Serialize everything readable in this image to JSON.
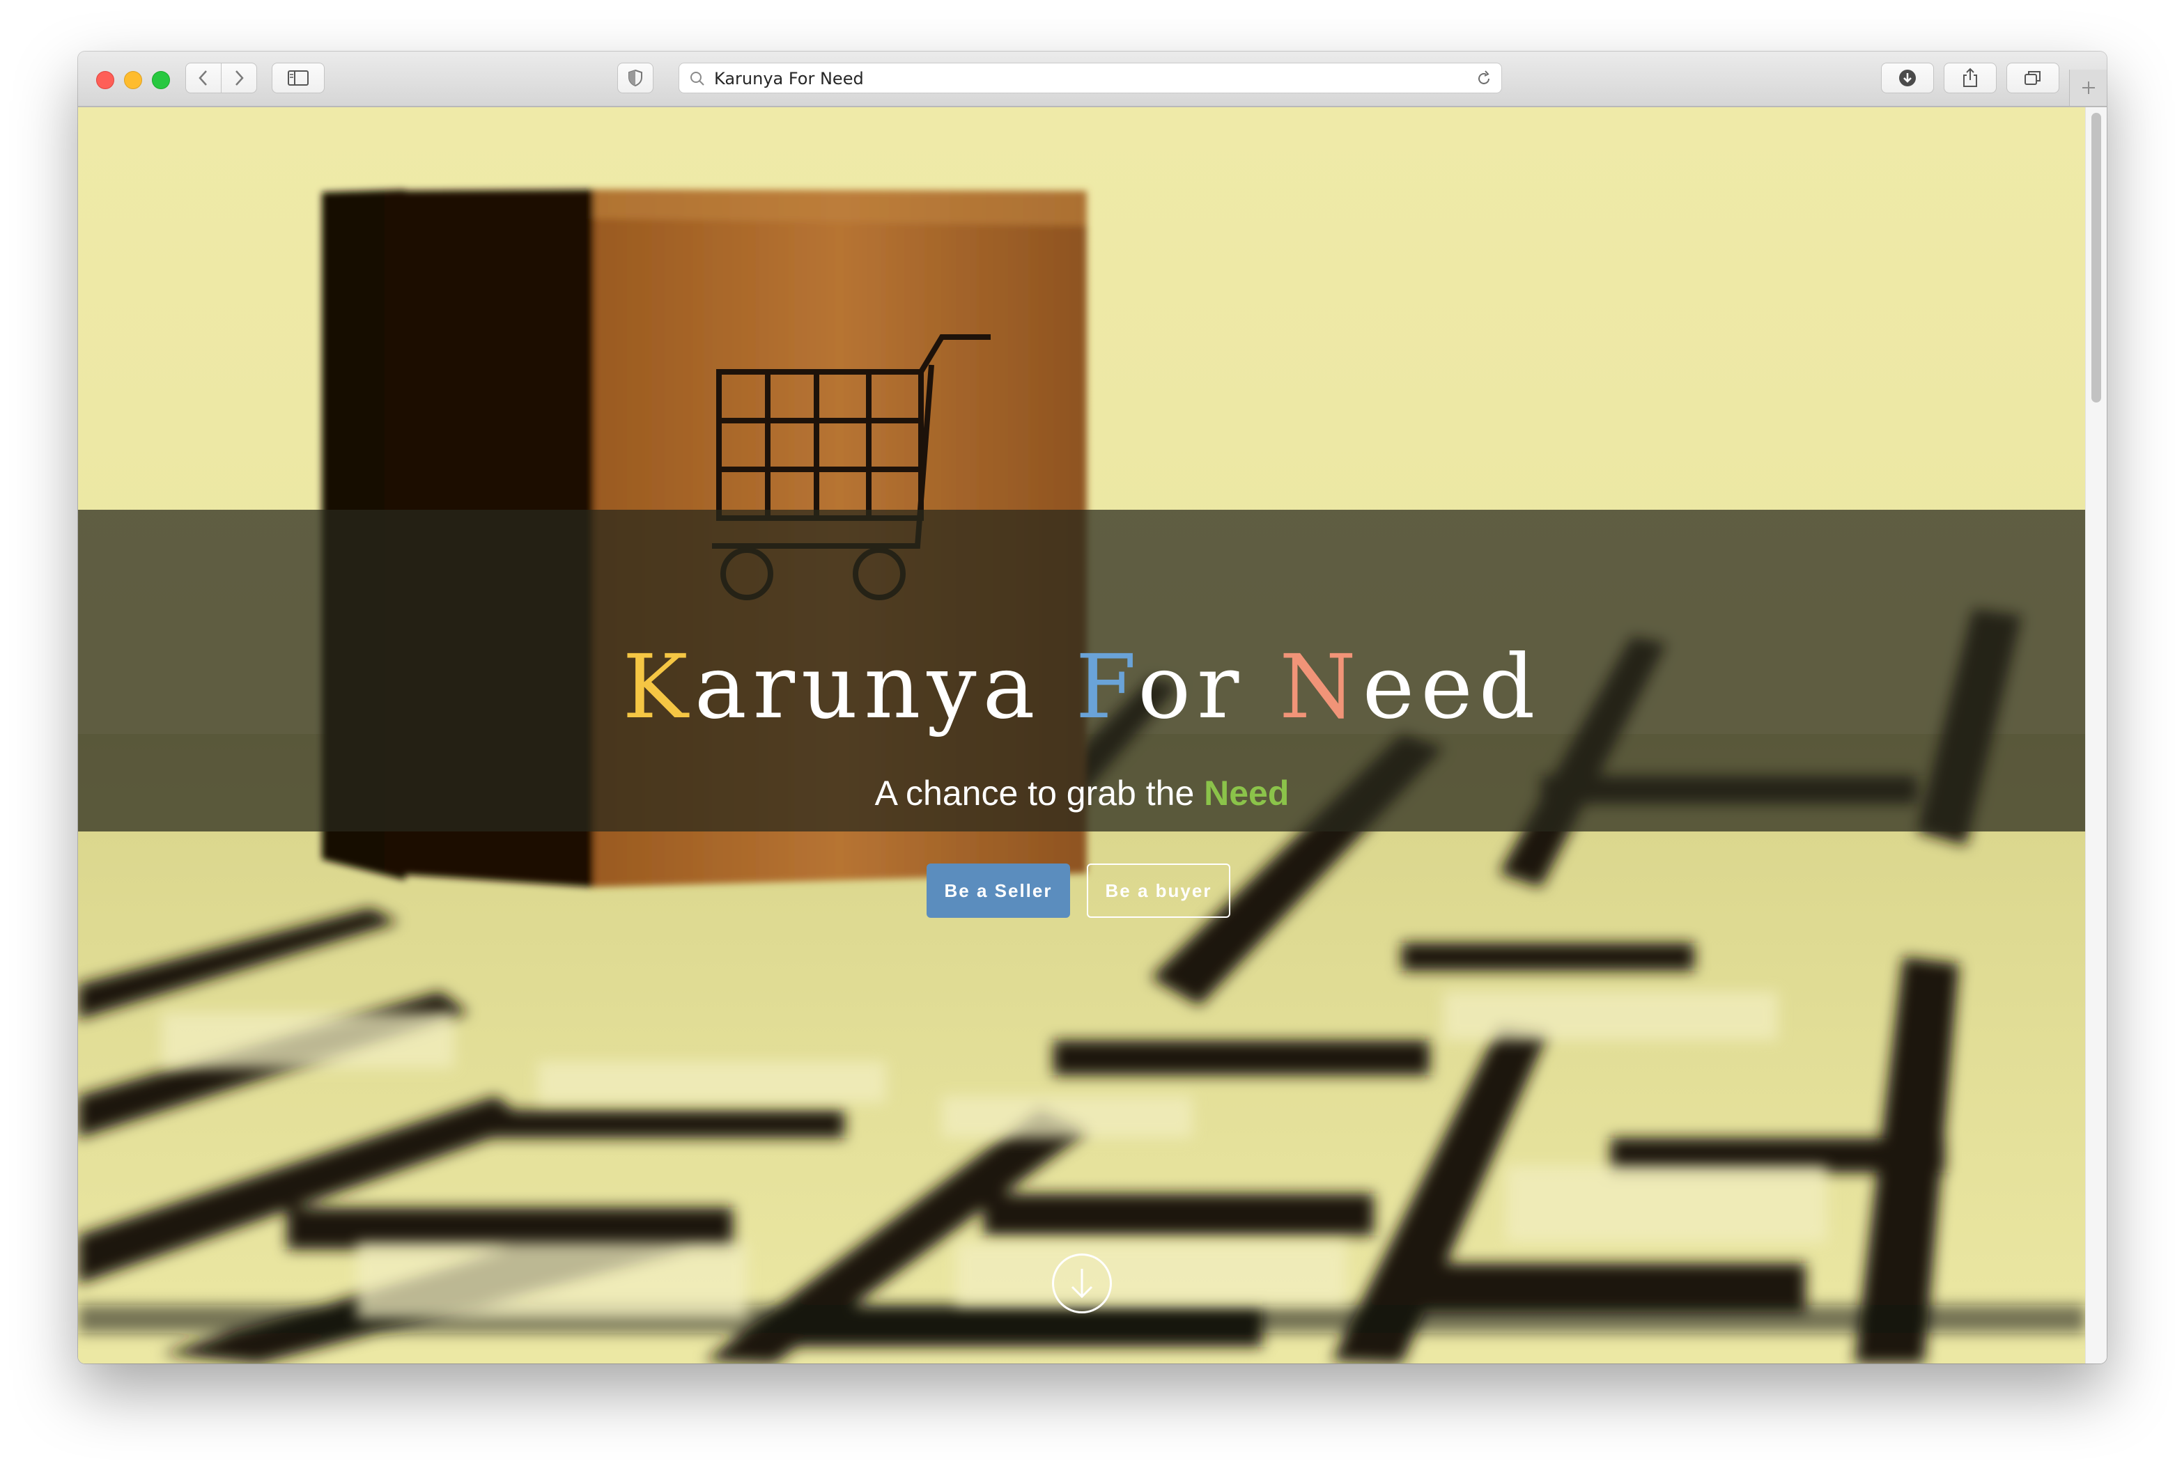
{
  "browser": {
    "address_text": "Karunya For Need"
  },
  "hero": {
    "title_parts": {
      "k": "K",
      "arunya": "arunya ",
      "f": "F",
      "or": "or ",
      "n": "N",
      "eed": "eed"
    },
    "subtitle_prefix": "A chance to grab the ",
    "subtitle_highlight": "Need",
    "seller_button": "Be a Seller",
    "buyer_button": "Be a buyer",
    "scroll_icon": "arrow-down-circle-icon"
  },
  "colors": {
    "k_letter": "#f5c644",
    "f_letter": "#6aa3d8",
    "n_letter": "#f19478",
    "need_highlight": "#8bc34a",
    "seller_button_bg": "#5b8dbe"
  }
}
